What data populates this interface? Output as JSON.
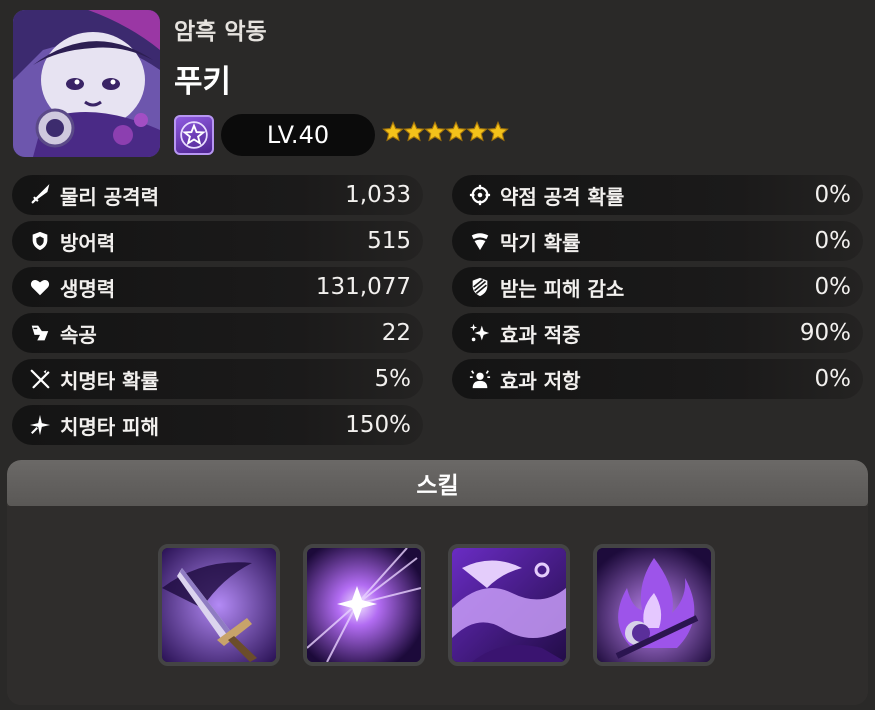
{
  "character": {
    "subtitle": "암흑 악동",
    "name": "푸키",
    "level": "LV.40",
    "stars": 6,
    "class_icon": "star-class-icon"
  },
  "stats_left": [
    {
      "label": "물리 공격력",
      "value": "1,033",
      "icon": "sword-icon"
    },
    {
      "label": "방어력",
      "value": "515",
      "icon": "shield-icon"
    },
    {
      "label": "생명력",
      "value": "131,077",
      "icon": "heart-icon"
    },
    {
      "label": "속공",
      "value": "22",
      "icon": "speed-icon"
    },
    {
      "label": "치명타 확률",
      "value": "5%",
      "icon": "crit-rate-icon"
    },
    {
      "label": "치명타 피해",
      "value": "150%",
      "icon": "crit-damage-icon"
    }
  ],
  "stats_right": [
    {
      "label": "약점 공격 확률",
      "value": "0%",
      "icon": "crosshair-icon"
    },
    {
      "label": "막기 확률",
      "value": "0%",
      "icon": "block-icon"
    },
    {
      "label": "받는 피해 감소",
      "value": "0%",
      "icon": "damage-reduction-icon"
    },
    {
      "label": "효과 적중",
      "value": "90%",
      "icon": "effect-hit-icon"
    },
    {
      "label": "효과 저항",
      "value": "0%",
      "icon": "effect-resist-icon"
    }
  ],
  "skills": {
    "title": "스킬",
    "items": [
      {
        "icon": "dagger-skill-icon"
      },
      {
        "icon": "burst-skill-icon"
      },
      {
        "icon": "wave-skill-icon"
      },
      {
        "icon": "flame-skill-icon"
      }
    ]
  },
  "colors": {
    "background": "#2a2928",
    "row_bg": "#141414",
    "skill_header": "#636160",
    "star": "#f4c21a",
    "accent_purple": "#7a3fd1"
  }
}
